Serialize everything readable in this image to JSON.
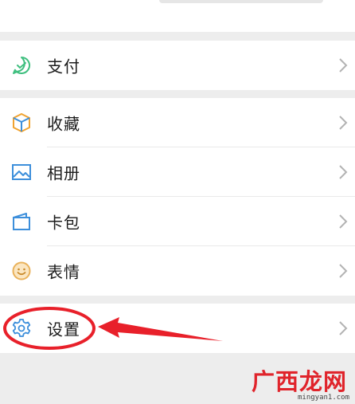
{
  "menu": {
    "pay": {
      "label": "支付",
      "icon": "pay-icon"
    },
    "collect": {
      "label": "收藏",
      "icon": "cube-icon"
    },
    "album": {
      "label": "相册",
      "icon": "picture-icon"
    },
    "cards": {
      "label": "卡包",
      "icon": "wallet-icon"
    },
    "stickers": {
      "label": "表情",
      "icon": "smiley-icon"
    },
    "settings": {
      "label": "设置",
      "icon": "gear-icon"
    }
  },
  "annotation": {
    "circle_color": "#e8202a",
    "arrow_color": "#e8202a"
  },
  "watermark": {
    "title": "广西龙网",
    "url": "mingyan1.com"
  },
  "colors": {
    "background": "#ededed",
    "pay_green": "#3fbf7f",
    "cube_orange": "#f0a331",
    "album_blue": "#3d8fdb",
    "chevron": "#b3b3b3"
  }
}
